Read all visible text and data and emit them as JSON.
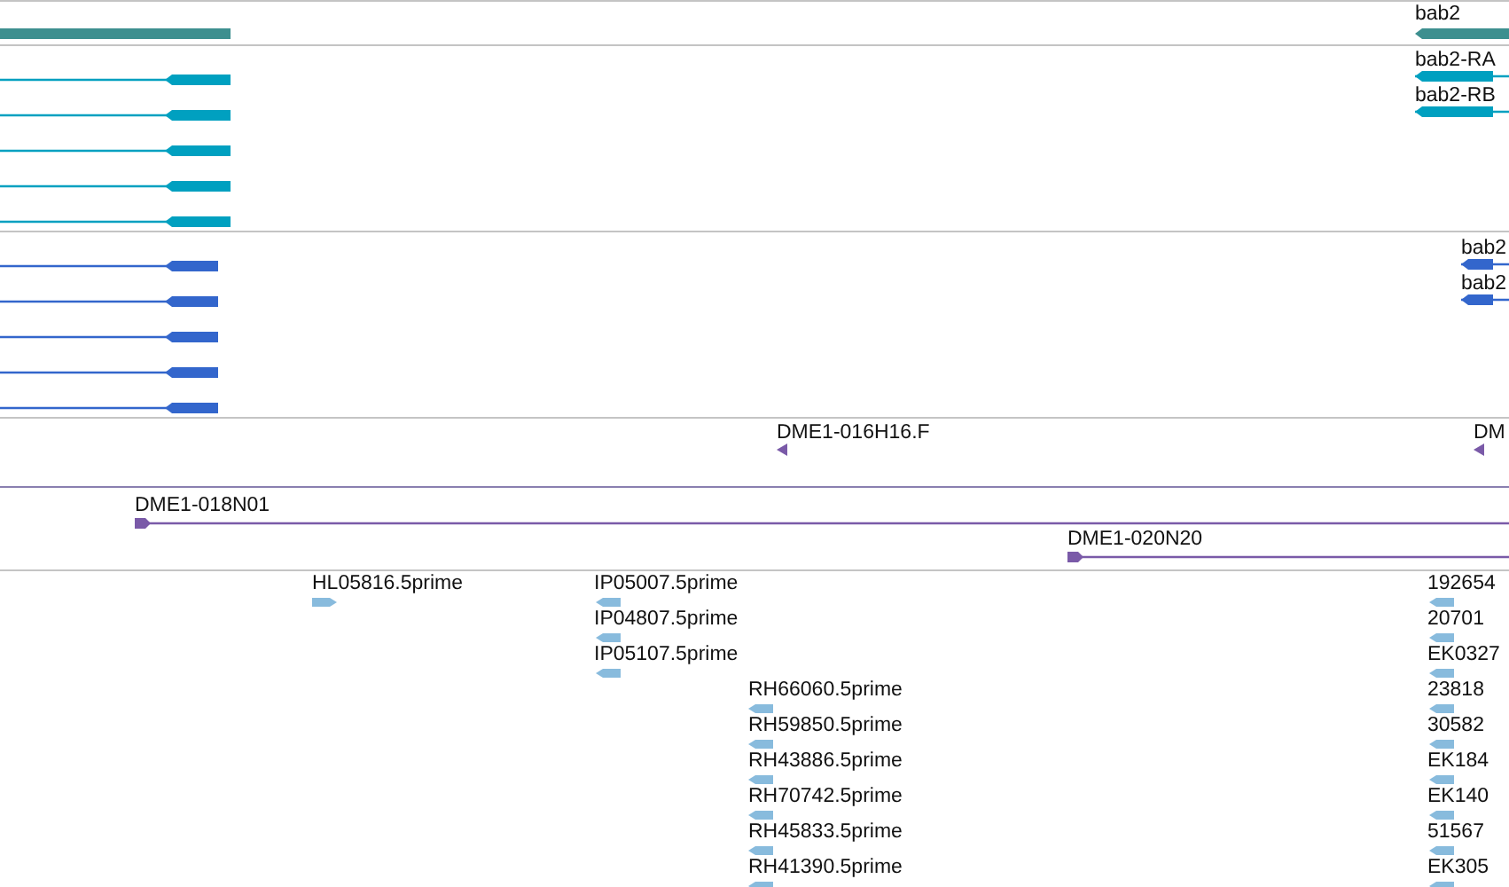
{
  "tracks": [
    {
      "kind": "gene",
      "features": [
        {
          "truncated": true
        },
        {
          "label": "bab2",
          "reverse": true
        }
      ]
    },
    {
      "kind": "transcript",
      "features": [
        {
          "reverse": true
        },
        {
          "reverse": true
        },
        {
          "reverse": true
        },
        {
          "reverse": true
        },
        {
          "reverse": true
        },
        {
          "label": "bab2-RA",
          "reverse": true
        },
        {
          "label": "bab2-RB",
          "reverse": true
        }
      ]
    },
    {
      "kind": "cds",
      "features": [
        {
          "reverse": true
        },
        {
          "reverse": true
        },
        {
          "reverse": true
        },
        {
          "reverse": true
        },
        {
          "reverse": true
        },
        {
          "label": "bab2",
          "reverse": true
        },
        {
          "label": "bab2",
          "reverse": true
        }
      ]
    },
    {
      "kind": "clone_end",
      "features": [
        {
          "label": "DME1-016H16.F",
          "reverse": true
        },
        {
          "label": "DM",
          "reverse": true
        }
      ]
    },
    {
      "kind": "clone",
      "features": [
        {
          "label": "DME1-018N01",
          "reverse": false
        },
        {
          "label": "DME1-020N20",
          "reverse": false
        }
      ]
    },
    {
      "kind": "est",
      "features": [
        {
          "label": "HL05816.5prime",
          "reverse": false
        },
        {
          "label": "IP05007.5prime",
          "reverse": true
        },
        {
          "label": "IP04807.5prime",
          "reverse": true
        },
        {
          "label": "IP05107.5prime",
          "reverse": true
        },
        {
          "label": "RH66060.5prime",
          "reverse": true
        },
        {
          "label": "RH59850.5prime",
          "reverse": true
        },
        {
          "label": "RH43886.5prime",
          "reverse": true
        },
        {
          "label": "RH70742.5prime",
          "reverse": true
        },
        {
          "label": "RH45833.5prime",
          "reverse": true
        },
        {
          "label": "RH41390.5prime",
          "reverse": true
        },
        {
          "label": "192654",
          "reverse": true
        },
        {
          "label": "20701",
          "reverse": true
        },
        {
          "label": "EK0327",
          "reverse": true
        },
        {
          "label": "23818",
          "reverse": true
        },
        {
          "label": "30582",
          "reverse": true
        },
        {
          "label": "EK184",
          "reverse": true
        },
        {
          "label": "EK140",
          "reverse": true
        },
        {
          "label": "51567",
          "reverse": true
        },
        {
          "label": "EK305",
          "reverse": true
        }
      ]
    }
  ]
}
